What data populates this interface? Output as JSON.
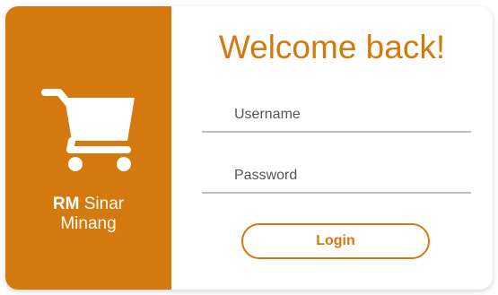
{
  "brand": {
    "name_bold": "RM",
    "name_rest": "Sinar",
    "name_line2": "Minang",
    "icon": "shopping-cart-icon"
  },
  "title": "Welcome back!",
  "username": {
    "placeholder": "Username",
    "value": ""
  },
  "password": {
    "placeholder": "Password",
    "value": ""
  },
  "login_label": "Login",
  "colors": {
    "accent": "#d4790e",
    "underline": "#bfbfbf",
    "background": "#ffffff"
  }
}
